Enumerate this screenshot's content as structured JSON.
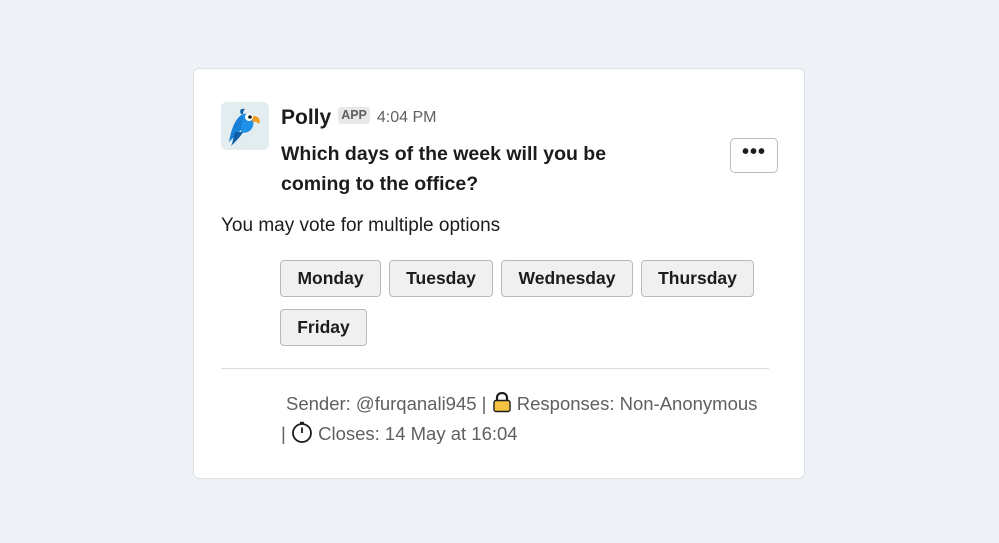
{
  "message": {
    "sender_name": "Polly",
    "app_badge": "APP",
    "timestamp": "4:04 PM",
    "question": "Which days of the week will you be coming to the office?",
    "instructions": "You may vote for multiple options",
    "more_label": "•••"
  },
  "options": [
    {
      "label": "Monday"
    },
    {
      "label": "Tuesday"
    },
    {
      "label": "Wednesday"
    },
    {
      "label": "Thursday"
    },
    {
      "label": "Friday"
    }
  ],
  "footer": {
    "sender": "Sender: @furqanali945 |",
    "responses": "Responses: Non-Anonymous",
    "separator": "|",
    "closes": "Closes: 14 May at 16:04"
  },
  "icons": {
    "avatar": "polly-parrot-icon",
    "responses": "lock-icon",
    "closes": "stopwatch-icon"
  },
  "colors": {
    "background": "#eef2f6",
    "card": "#ffffff",
    "button_bg": "#f0f0f0",
    "muted_text": "#616061",
    "parrot_blue": "#1a7fd6",
    "parrot_orange": "#f59a23"
  }
}
